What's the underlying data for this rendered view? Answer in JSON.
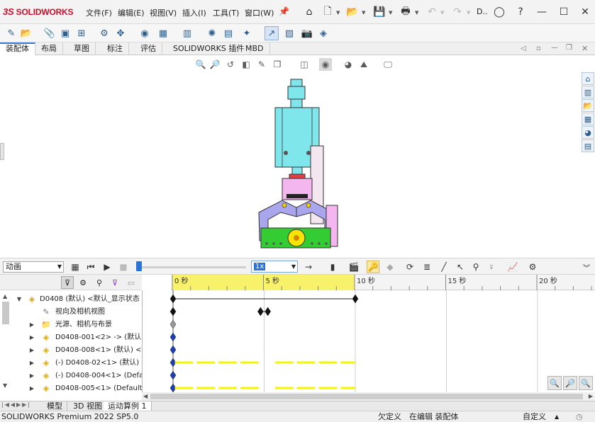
{
  "app": {
    "logo_ds": "3S",
    "logo_text": "SOLIDWORKS"
  },
  "menu": [
    {
      "label": "文件(F)"
    },
    {
      "label": "编辑(E)"
    },
    {
      "label": "视图(V)"
    },
    {
      "label": "插入(I)"
    },
    {
      "label": "工具(T)"
    },
    {
      "label": "窗口(W)"
    }
  ],
  "title_short": "D..",
  "command_tabs": [
    "装配体",
    "布局",
    "草图",
    "标注",
    "评估",
    "SOLIDWORKS 插件",
    "MBD"
  ],
  "motion": {
    "study_type": "动画",
    "speed": "1x"
  },
  "timeline": {
    "ticks": [
      {
        "label": "0 秒",
        "t": 0
      },
      {
        "label": "5 秒",
        "t": 5
      },
      {
        "label": "10 秒",
        "t": 10
      },
      {
        "label": "15 秒",
        "t": 15
      },
      {
        "label": "20 秒",
        "t": 20
      }
    ],
    "highlight_end_seconds": 10
  },
  "tree": [
    {
      "label": "D0408 (默认) <默认_显示状态",
      "indent": 0,
      "expand": "▼",
      "icon": "assembly-icon"
    },
    {
      "label": "视向及相机视图",
      "indent": 1,
      "expand": "",
      "icon": "camera-icon"
    },
    {
      "label": "光源、相机与布景",
      "indent": 1,
      "expand": "▶",
      "icon": "folder-icon"
    },
    {
      "label": "D0408-001<2> -> (默认)",
      "indent": 1,
      "expand": "▶",
      "icon": "part-icon"
    },
    {
      "label": "D0408-008<1> (默认) <-",
      "indent": 1,
      "expand": "▶",
      "icon": "part-icon"
    },
    {
      "label": "(-) D0408-02<1> (默认)",
      "indent": 1,
      "expand": "▶",
      "icon": "part-icon"
    },
    {
      "label": "(-) D0408-004<1> (Defa",
      "indent": 1,
      "expand": "▶",
      "icon": "part-icon"
    },
    {
      "label": "D0408-005<1> (Default)",
      "indent": 1,
      "expand": "▶",
      "icon": "part-icon"
    }
  ],
  "bottom_tabs": [
    "模型",
    "3D 视图",
    "运动算例 1"
  ],
  "status": {
    "left": "SOLIDWORKS Premium 2022 SP5.0",
    "underdefined": "欠定义",
    "editing": "在编辑 装配体",
    "custom": "自定义"
  },
  "colors": {
    "accent": "#2b74d6",
    "brand": "#c8102e",
    "timeline_yellow": "#f5f500",
    "key_blue": "#1c3fb5",
    "cylinder": "#7fe6ec",
    "gripper": "#a9a6ee",
    "base_green": "#33cc33",
    "pink": "#f3b6ee"
  }
}
